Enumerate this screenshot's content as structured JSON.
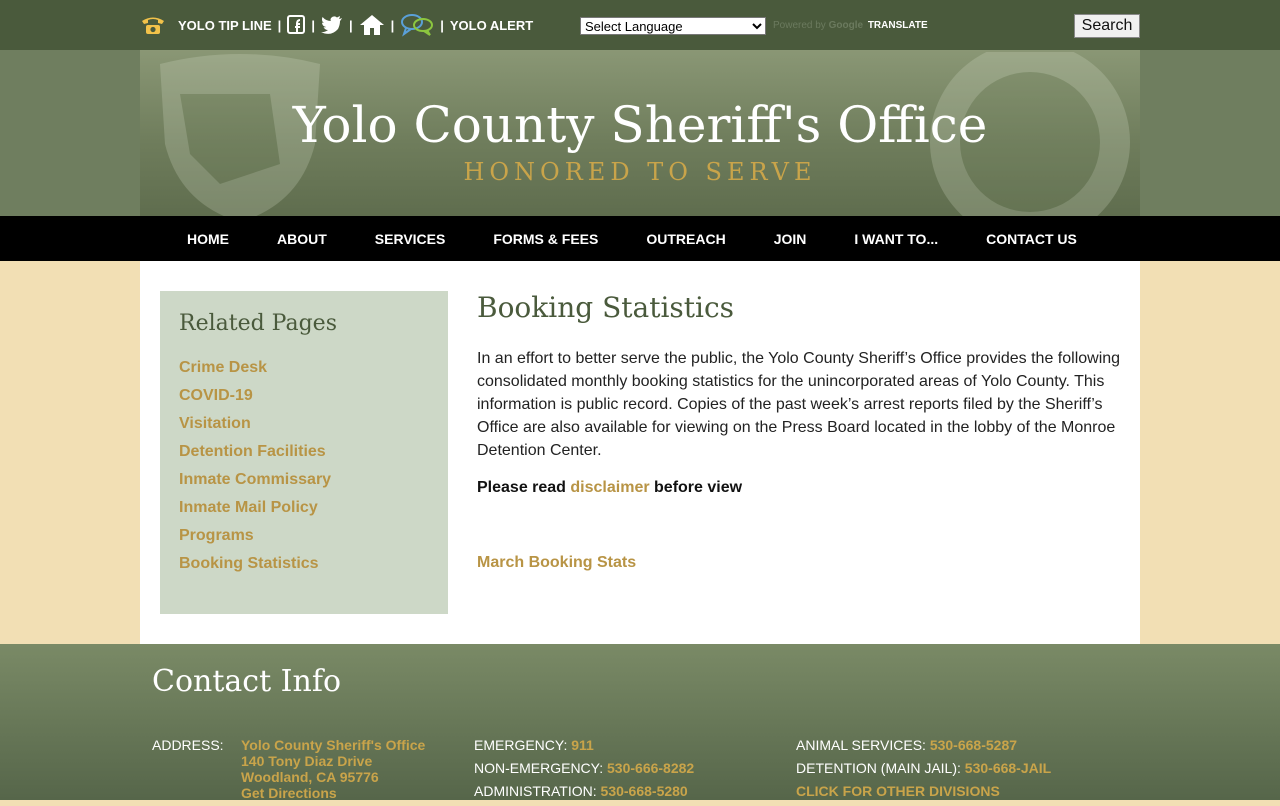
{
  "topbar": {
    "tip_line": "YOLO TIP LINE",
    "alert": "YOLO ALERT",
    "separator": "|",
    "language_select": "Select Language",
    "powered_by": "Powered by",
    "google": "Google",
    "translate": "TRANSLATE",
    "search_label": "Search"
  },
  "header": {
    "title": "Yolo County Sheriff's Office",
    "tagline": "HONORED TO SERVE"
  },
  "nav": {
    "items": [
      {
        "label": "HOME"
      },
      {
        "label": "ABOUT"
      },
      {
        "label": "SERVICES"
      },
      {
        "label": "FORMS & FEES"
      },
      {
        "label": "OUTREACH"
      },
      {
        "label": "JOIN"
      },
      {
        "label": "I WANT TO..."
      },
      {
        "label": "CONTACT US"
      }
    ]
  },
  "sidebar": {
    "title": "Related Pages",
    "items": [
      {
        "label": "Crime Desk"
      },
      {
        "label": "COVID-19"
      },
      {
        "label": "Visitation"
      },
      {
        "label": "Detention Facilities"
      },
      {
        "label": "Inmate Commissary"
      },
      {
        "label": "Inmate Mail Policy"
      },
      {
        "label": "Programs"
      },
      {
        "label": "Booking Statistics"
      }
    ]
  },
  "content": {
    "title": "Booking Statistics",
    "intro": "In an effort to better serve the public, the Yolo County Sheriff’s Office provides the following consolidated monthly booking statistics for the unincorporated areas of Yolo County. This information is public record. Copies of the past week’s arrest reports filed by the Sheriff’s Office are also available for viewing on the Press Board located in the lobby of the Monroe Detention Center.",
    "disclaimer_prefix": "Please read",
    "disclaimer_link": "disclaimer",
    "disclaimer_suffix": "before view",
    "stats_link": "March Booking Stats"
  },
  "footer": {
    "title": "Contact Info",
    "address_label": "ADDRESS:",
    "address_lines": [
      "Yolo County Sheriff's Office",
      "140 Tony Diaz Drive",
      "Woodland, CA 95776",
      "Get Directions"
    ],
    "col2": [
      {
        "label": "EMERGENCY:",
        "value": "911"
      },
      {
        "label": "NON-EMERGENCY:",
        "value": "530-666-8282"
      },
      {
        "label": "ADMINISTRATION:",
        "value": "530-668-5280"
      }
    ],
    "col3": [
      {
        "label": "ANIMAL SERVICES:",
        "value": "530-668-5287"
      },
      {
        "label": "DETENTION (MAIN JAIL):",
        "value": "530-668-JAIL"
      },
      {
        "label": "",
        "value": "CLICK FOR OTHER DIVISIONS"
      }
    ]
  }
}
